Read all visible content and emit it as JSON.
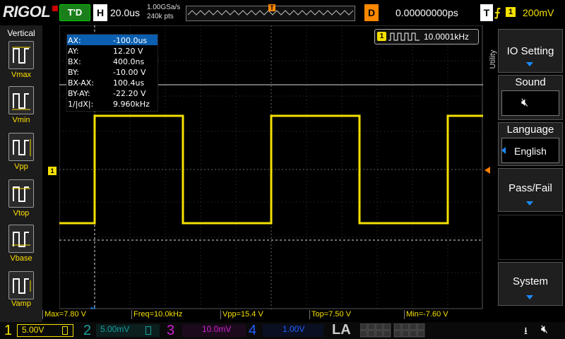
{
  "top": {
    "brand": "RIGOL",
    "run_status": "T'D",
    "horizontal_letter": "H",
    "timebase": "20.0us",
    "sample_rate": "1.00GSa/s",
    "memory_depth": "240k pts",
    "delay_letter": "D",
    "delay_value": "0.00000000ps",
    "trigger_letter": "T",
    "trigger_source": "1",
    "trigger_level": "200mV"
  },
  "left_panel": {
    "title": "Vertical",
    "items": [
      {
        "label": "Vmax"
      },
      {
        "label": "Vmin"
      },
      {
        "label": "Vpp"
      },
      {
        "label": "Vtop"
      },
      {
        "label": "Vbase"
      },
      {
        "label": "Vamp"
      }
    ]
  },
  "cursor": {
    "rows": [
      {
        "name": "AX:",
        "value": "-100.0us"
      },
      {
        "name": "AY:",
        "value": "12.20 V"
      },
      {
        "name": "BX:",
        "value": "400.0ns"
      },
      {
        "name": "BY:",
        "value": "-10.00 V"
      },
      {
        "name": "BX-AX:",
        "value": "100.4us"
      },
      {
        "name": "BY-AY:",
        "value": "-22.20 V"
      },
      {
        "name": "1/|dX|:",
        "value": "9.960kHz"
      }
    ]
  },
  "freq_counter": {
    "channel": "1",
    "value": "10.0001kHz"
  },
  "right_panel": {
    "utility_tab": "Utility",
    "io_setting": "IO Setting",
    "sound_title": "Sound",
    "language_title": "Language",
    "language_value": "English",
    "pass_fail": "Pass/Fail",
    "system": "System"
  },
  "markers": {
    "trigger_top": "T",
    "channel_level": "1"
  },
  "measurements": [
    {
      "text": "Max=7.80 V"
    },
    {
      "text": "Freq=10.0kHz"
    },
    {
      "text": "Vpp=15.4 V"
    },
    {
      "text": "Top=7.50 V"
    },
    {
      "text": "Min=-7.60 V"
    }
  ],
  "channels": [
    {
      "num": "1",
      "scale": "5.00V",
      "color": "#f5e000"
    },
    {
      "num": "2",
      "scale": "5.00mV",
      "color": "#16a0a0"
    },
    {
      "num": "3",
      "scale": "10.0mV",
      "color": "#d020d0"
    },
    {
      "num": "4",
      "scale": "1.00V",
      "color": "#2060ff"
    }
  ],
  "la_label": "LA",
  "colors": {
    "ch1": "#f5e000",
    "accent": "#1a8cff",
    "trigger": "#ff8000"
  }
}
